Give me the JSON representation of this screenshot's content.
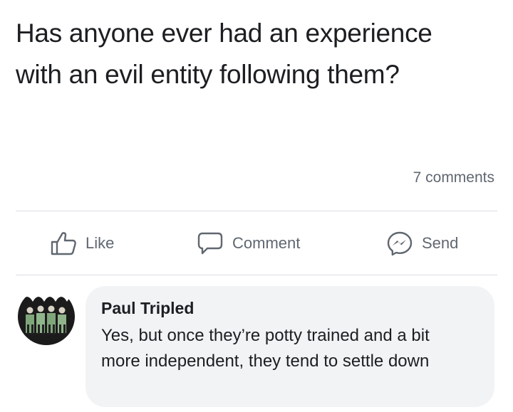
{
  "post": {
    "text": "Has anyone ever had an experience with an evil entity following them?",
    "comment_count": "7 comments"
  },
  "actions": {
    "like_label": "Like",
    "comment_label": "Comment",
    "send_label": "Send"
  },
  "comment": {
    "author": "Paul Tripled",
    "text": "Yes, but once they’re potty trained and a bit more independent, they tend to settle down"
  },
  "icons": {
    "like": "thumbs-up-icon",
    "comment": "speech-bubble-icon",
    "send": "messenger-icon",
    "avatar": "avatar-image"
  },
  "colors": {
    "text": "#1c1e21",
    "secondary_text": "#606770",
    "divider": "#dadde1",
    "bubble": "#f2f3f5"
  }
}
